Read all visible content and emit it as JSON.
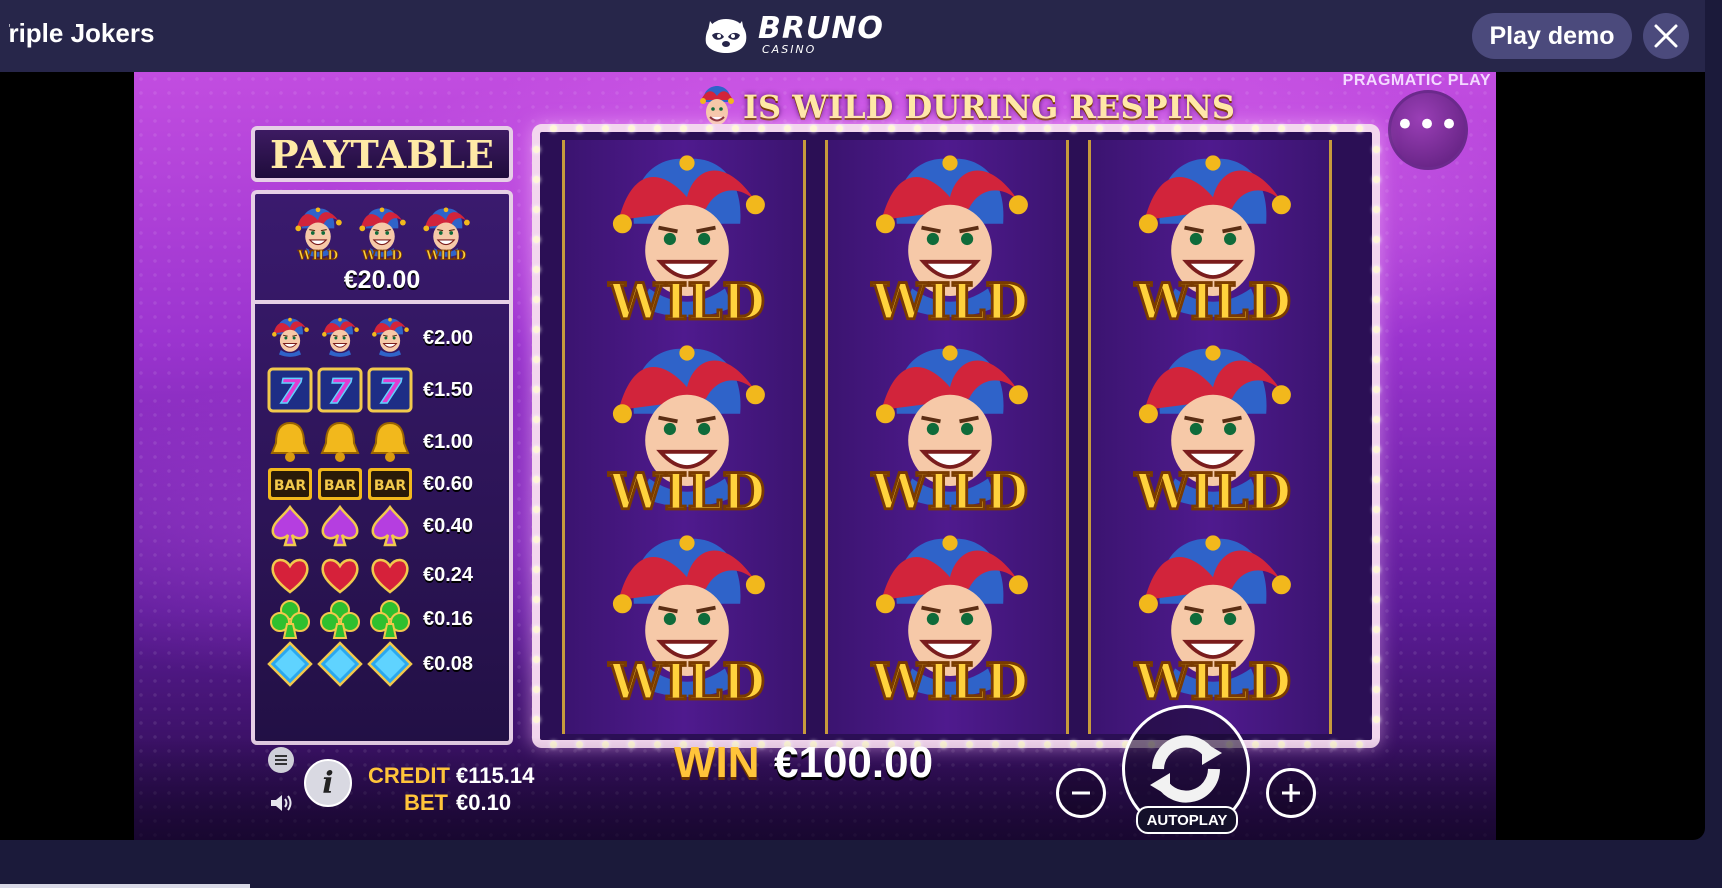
{
  "header": {
    "game_title": "Triple Jokers",
    "brand_name": "BRUNO",
    "brand_sub": "CASINO",
    "play_demo_label": "Play demo"
  },
  "game": {
    "provider": "PRAGMATIC PLAY",
    "banner": "IS WILD DURING RESPINS",
    "paytable": {
      "title": "PAYTABLE",
      "top": {
        "symbol": "joker-wild",
        "value": "€20.00"
      },
      "rows": [
        {
          "symbol": "joker",
          "value": "€2.00"
        },
        {
          "symbol": "seven",
          "value": "€1.50"
        },
        {
          "symbol": "bell",
          "value": "€1.00"
        },
        {
          "symbol": "bar",
          "value": "€0.60"
        },
        {
          "symbol": "spade",
          "value": "€0.40"
        },
        {
          "symbol": "heart",
          "value": "€0.24"
        },
        {
          "symbol": "club",
          "value": "€0.16"
        },
        {
          "symbol": "diamond",
          "value": "€0.08"
        }
      ]
    },
    "wild_label": "WILD",
    "bar_label": "BAR",
    "seven_label": "7",
    "reels": [
      [
        "joker-wild",
        "joker-wild",
        "joker-wild"
      ],
      [
        "joker-wild",
        "joker-wild",
        "joker-wild"
      ],
      [
        "joker-wild",
        "joker-wild",
        "joker-wild"
      ]
    ],
    "credit_label": "CREDIT",
    "credit_value": "€115.14",
    "bet_label": "BET",
    "bet_value": "€0.10",
    "win_label": "WIN",
    "win_value": "€100.00",
    "autoplay_label": "AUTOPLAY"
  },
  "colors": {
    "accent_gold": "#ffc43a",
    "topbar": "#27264a",
    "button": "#4b4a7c"
  }
}
